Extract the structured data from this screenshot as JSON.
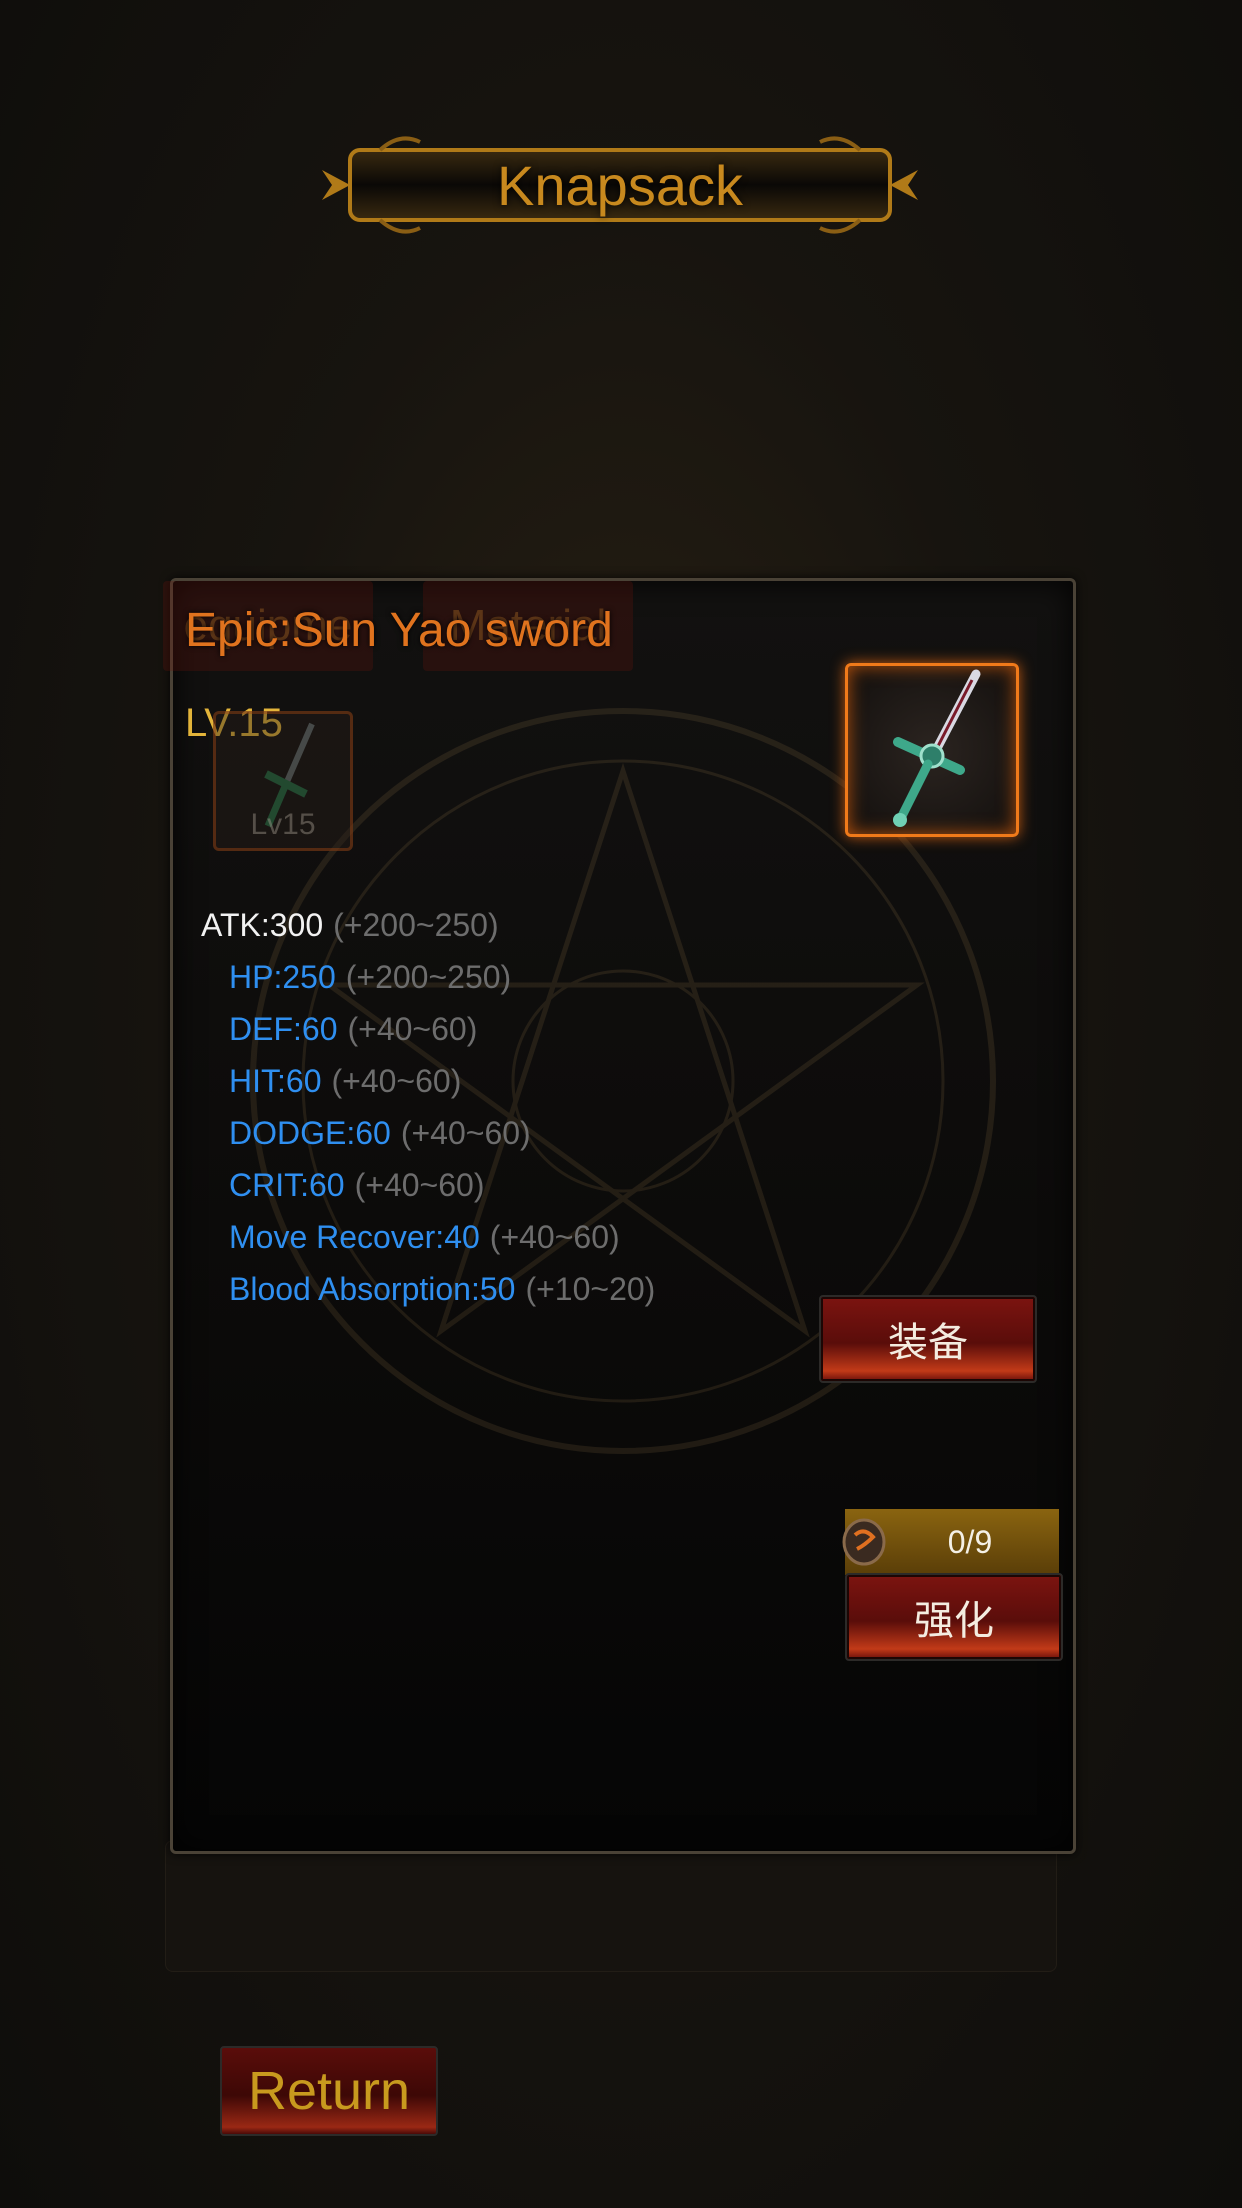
{
  "header": {
    "title": "Knapsack"
  },
  "tabs": {
    "equipment_label": "equipme",
    "material_label": "Material"
  },
  "item": {
    "name": "Epic:Sun Yao sword",
    "level_label": "LV.15",
    "slot_level_label": "Lv15",
    "icon": "sword-icon"
  },
  "stats": [
    {
      "label": "ATK:300",
      "range": "(+200~250)",
      "kind": "main"
    },
    {
      "label": "HP:250",
      "range": "(+200~250)",
      "kind": "sub"
    },
    {
      "label": "DEF:60",
      "range": "(+40~60)",
      "kind": "sub"
    },
    {
      "label": "HIT:60",
      "range": "(+40~60)",
      "kind": "sub"
    },
    {
      "label": "DODGE:60",
      "range": "(+40~60)",
      "kind": "sub"
    },
    {
      "label": "CRIT:60",
      "range": "(+40~60)",
      "kind": "sub"
    },
    {
      "label": "Move Recover:40",
      "range": "(+40~60)",
      "kind": "sub"
    },
    {
      "label": "Blood Absorption:50",
      "range": "(+10~20)",
      "kind": "sub"
    }
  ],
  "actions": {
    "equip_label": "装备",
    "enhance_count": "0/9",
    "enhance_label": "强化",
    "return_label": "Return"
  },
  "colors": {
    "title": "#c8891e",
    "item_name": "#e0731e",
    "level": "#e3b43a",
    "main_stat": "#f2f2f2",
    "sub_stat": "#2f8ff0",
    "range": "#6d6d6d"
  }
}
